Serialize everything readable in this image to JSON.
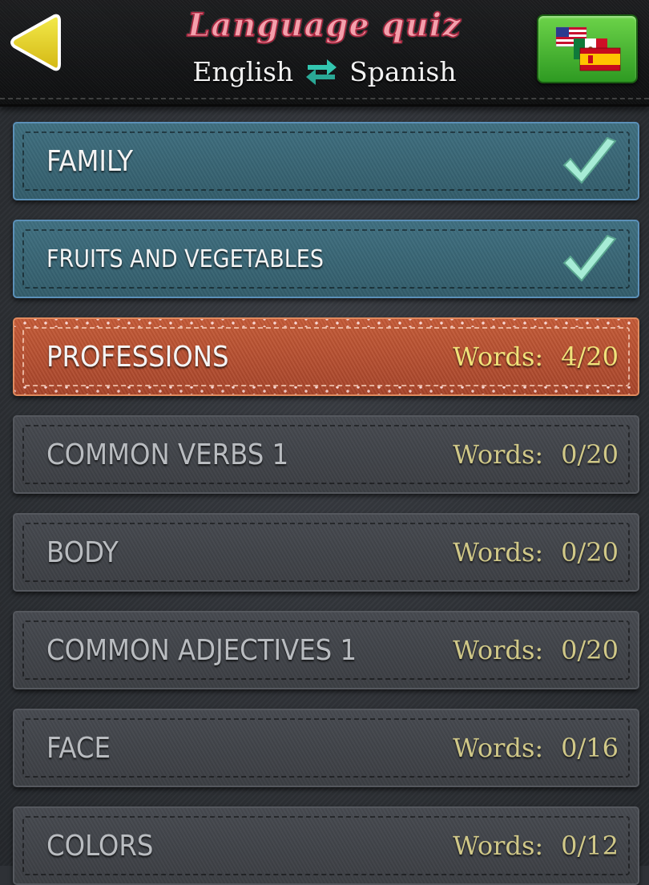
{
  "header": {
    "title": "Language quiz",
    "source_language": "English",
    "target_language": "Spanish",
    "back_icon": "back-arrow-icon",
    "swap_icon": "swap-arrows-icon",
    "flags_icon": "language-flags-icon"
  },
  "categories": [
    {
      "label": "FAMILY",
      "status": "completed",
      "words": ""
    },
    {
      "label": "FRUITS AND VEGETABLES",
      "status": "completed",
      "words": ""
    },
    {
      "label": "PROFESSIONS",
      "status": "in-progress",
      "words_label": "Words:",
      "words": "4/20"
    },
    {
      "label": "COMMON VERBS 1",
      "status": "locked",
      "words_label": "Words:",
      "words": "0/20"
    },
    {
      "label": "BODY",
      "status": "locked",
      "words_label": "Words:",
      "words": "0/20"
    },
    {
      "label": "COMMON ADJECTIVES 1",
      "status": "locked",
      "words_label": "Words:",
      "words": "0/20"
    },
    {
      "label": "FACE",
      "status": "locked",
      "words_label": "Words:",
      "words": "0/16"
    },
    {
      "label": "COLORS",
      "status": "locked",
      "words_label": "Words:",
      "words": "0/12"
    }
  ],
  "colors": {
    "completed": "#3f6f80",
    "in_progress": "#c45a37",
    "locked": "#474a50",
    "words_text": "#f0e27a",
    "check": "#8fe0c8"
  }
}
